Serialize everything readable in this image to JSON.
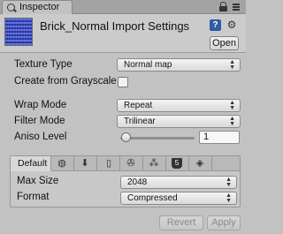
{
  "window": {
    "tab_label": "Inspector"
  },
  "header": {
    "title": "Brick_Normal Import Settings",
    "help_glyph": "?",
    "open_label": "Open"
  },
  "settings": {
    "texture_type": {
      "label": "Texture Type",
      "value": "Normal map"
    },
    "create_from_grayscale": {
      "label": "Create from Grayscale",
      "checked": false
    },
    "wrap_mode": {
      "label": "Wrap Mode",
      "value": "Repeat"
    },
    "filter_mode": {
      "label": "Filter Mode",
      "value": "Trilinear"
    },
    "aniso_level": {
      "label": "Aniso Level",
      "value": "1",
      "slider_fraction": 0.0
    }
  },
  "platforms": {
    "tabs": [
      {
        "label": "Default",
        "icon": "default-tab"
      },
      {
        "icon": "globe-icon"
      },
      {
        "icon": "download-icon"
      },
      {
        "icon": "mobile-icon"
      },
      {
        "icon": "android-icon"
      },
      {
        "icon": "blackberry-icon"
      },
      {
        "icon": "html5-icon"
      },
      {
        "icon": "unity-cube-icon"
      }
    ],
    "max_size": {
      "label": "Max Size",
      "value": "2048"
    },
    "format": {
      "label": "Format",
      "value": "Compressed"
    }
  },
  "footer": {
    "revert_label": "Revert",
    "apply_label": "Apply"
  }
}
